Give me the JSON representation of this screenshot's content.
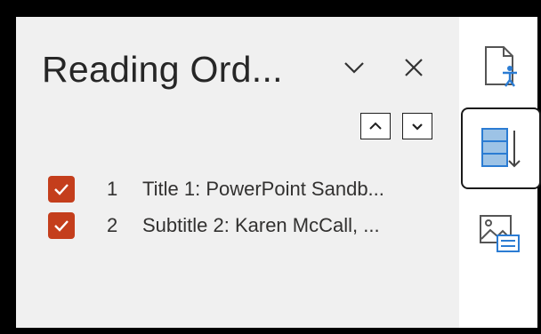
{
  "pane": {
    "title": "Reading Ord...",
    "options_icon": "chevron-down-icon",
    "close_icon": "close-icon",
    "move_up_icon": "chevron-up-icon",
    "move_down_icon": "chevron-down-icon"
  },
  "items": [
    {
      "number": "1",
      "label": "Title 1: PowerPoint Sandb...",
      "checked": true
    },
    {
      "number": "2",
      "label": "Subtitle 2: Karen McCall, ...",
      "checked": true
    }
  ],
  "rail": {
    "items": [
      {
        "icon": "accessibility-document-icon",
        "selected": false
      },
      {
        "icon": "reading-order-icon",
        "selected": true
      },
      {
        "icon": "alt-text-image-icon",
        "selected": false
      }
    ]
  },
  "colors": {
    "checkbox": "#c43e1c",
    "pane_background": "#f0f0f0",
    "rail_background": "#ffffff",
    "accent_blue": "#2b7cd3"
  }
}
